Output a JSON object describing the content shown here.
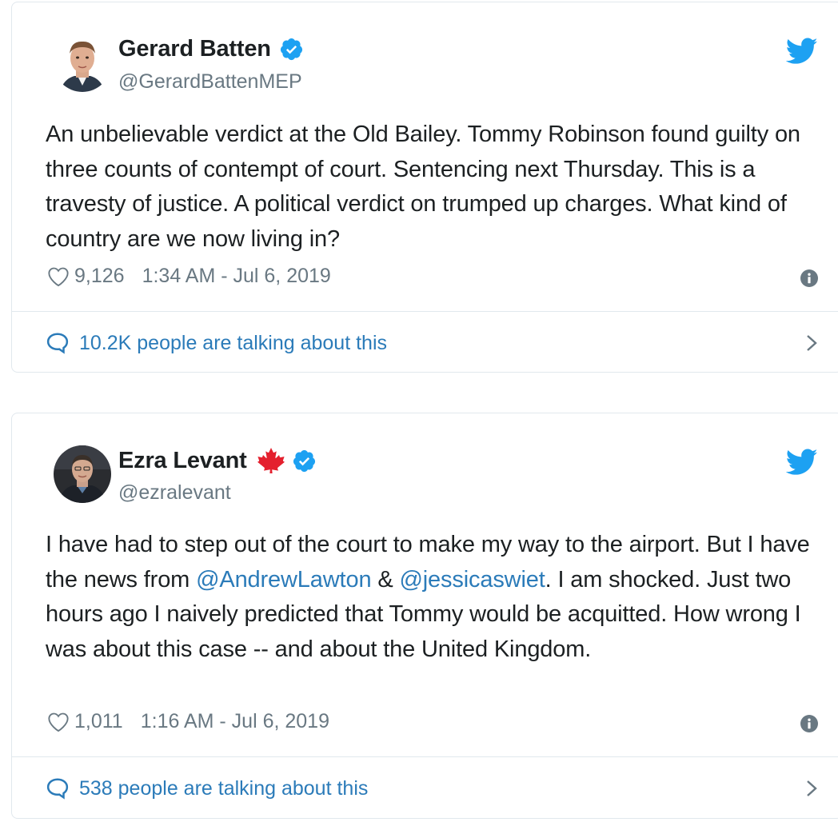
{
  "colors": {
    "text": "#1c2022",
    "secondary": "#697882",
    "link": "#2b7bb9",
    "twitter_blue": "#1da1f2",
    "border": "#e1e8ed"
  },
  "tweets": [
    {
      "author": {
        "name": "Gerard Batten",
        "handle": "@GerardBattenMEP",
        "verified_icon": "verified-badge-icon",
        "avatar": "avatar-photo"
      },
      "text": "An unbelievable verdict at the Old Bailey. Tommy Robinson found guilty on three counts of contempt of court. Sentencing next Thursday. This is a travesty of justice. A political verdict on trumped up charges. What kind of country are we now living in?",
      "likes": "9,126",
      "timestamp": "1:34 AM - Jul 6, 2019",
      "talking": "10.2K people are talking about this"
    },
    {
      "author": {
        "name": "Ezra Levant",
        "handle": "@ezralevant",
        "flag_icon": "maple-leaf-icon",
        "verified_icon": "verified-badge-icon",
        "avatar": "avatar-photo"
      },
      "text_parts": {
        "p1": "I have had to step out of the court to make my way to the airport. But I have the news from ",
        "mention1": "@AndrewLawton",
        "p2": " & ",
        "mention2": "@jessicaswiet",
        "p3": ". I am shocked. Just two hours ago I naively predicted that Tommy would be acquitted. How wrong I was about this case -- and about the United Kingdom."
      },
      "likes": "1,011",
      "timestamp": "1:16 AM - Jul 6, 2019",
      "talking": "538 people are talking about this"
    }
  ]
}
